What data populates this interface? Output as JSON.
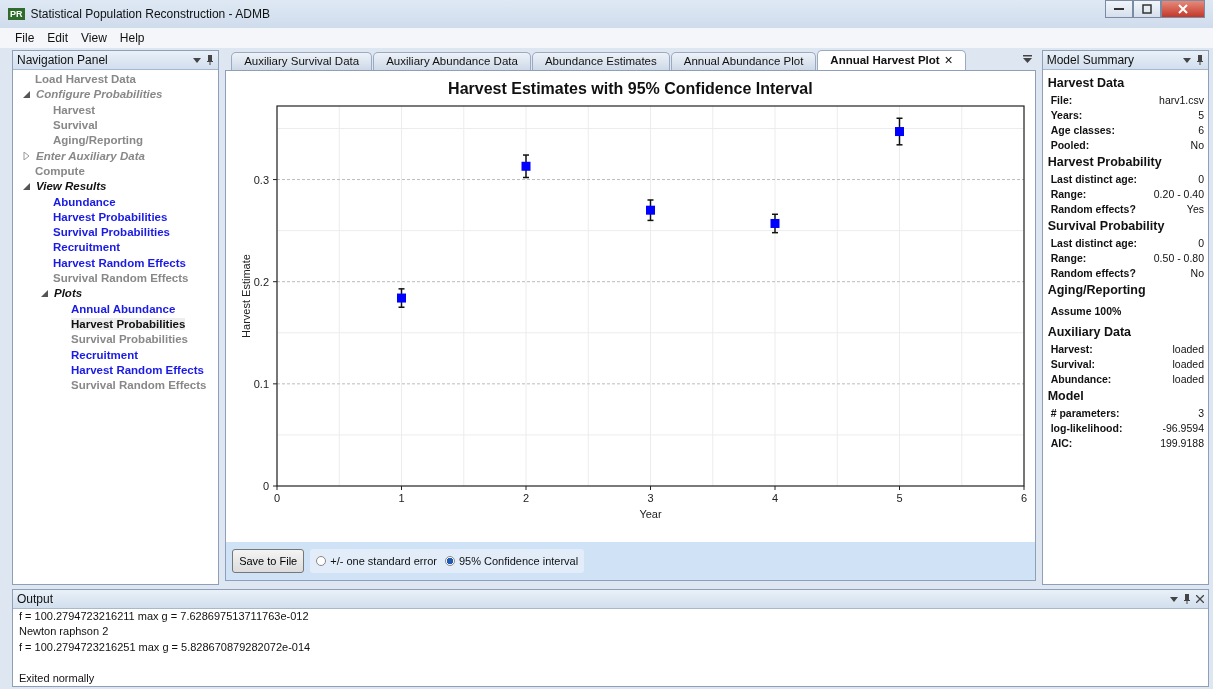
{
  "window": {
    "title": "Statistical Population Reconstruction - ADMB",
    "app_icon_text": "PR"
  },
  "menu": [
    "File",
    "Edit",
    "View",
    "Help"
  ],
  "navigation": {
    "title": "Navigation Panel",
    "items": [
      {
        "label": "Load Harvest Data",
        "kind": "item",
        "disabled": true,
        "selected": false
      },
      {
        "label": "Configure Probabilities",
        "kind": "group",
        "disabled": true,
        "expanded": true,
        "children": [
          {
            "label": "Harvest",
            "kind": "item",
            "disabled": true,
            "selected": false
          },
          {
            "label": "Survival",
            "kind": "item",
            "disabled": true,
            "selected": false
          },
          {
            "label": "Aging/Reporting",
            "kind": "item",
            "disabled": true,
            "selected": false
          }
        ]
      },
      {
        "label": "Enter Auxiliary Data",
        "kind": "group",
        "disabled": true,
        "expanded": false
      },
      {
        "label": "Compute",
        "kind": "item",
        "disabled": true,
        "selected": false
      },
      {
        "label": "View Results",
        "kind": "group",
        "disabled": false,
        "expanded": true,
        "children": [
          {
            "label": "Abundance",
            "kind": "item",
            "disabled": false,
            "selected": false
          },
          {
            "label": "Harvest Probabilities",
            "kind": "item",
            "disabled": false,
            "selected": false
          },
          {
            "label": "Survival Probabilities",
            "kind": "item",
            "disabled": false,
            "selected": false
          },
          {
            "label": "Recruitment",
            "kind": "item",
            "disabled": false,
            "selected": false
          },
          {
            "label": "Harvest Random Effects",
            "kind": "item",
            "disabled": false,
            "selected": false
          },
          {
            "label": "Survival Random Effects",
            "kind": "item",
            "disabled": true,
            "selected": false
          },
          {
            "label": "Plots",
            "kind": "group",
            "disabled": false,
            "expanded": true,
            "children": [
              {
                "label": "Annual Abundance",
                "kind": "item",
                "disabled": false,
                "selected": false
              },
              {
                "label": "Harvest Probabilities",
                "kind": "item",
                "disabled": false,
                "selected": true
              },
              {
                "label": "Survival Probabilities",
                "kind": "item",
                "disabled": true,
                "selected": false
              },
              {
                "label": "Recruitment",
                "kind": "item",
                "disabled": false,
                "selected": false
              },
              {
                "label": "Harvest Random Effects",
                "kind": "item",
                "disabled": false,
                "selected": false
              },
              {
                "label": "Survival Random Effects",
                "kind": "item",
                "disabled": true,
                "selected": false
              }
            ]
          }
        ]
      }
    ]
  },
  "tabs": [
    {
      "label": "Auxiliary Survival Data",
      "selected": false
    },
    {
      "label": "Auxiliary Abundance Data",
      "selected": false
    },
    {
      "label": "Abundance Estimates",
      "selected": false
    },
    {
      "label": "Annual Abundance Plot",
      "selected": false
    },
    {
      "label": "Annual Harvest Plot",
      "selected": true,
      "close": "×"
    }
  ],
  "plot": {
    "chart_data": {
      "type": "scatter",
      "title": "Harvest Estimates with 95% Confidence Interval",
      "xlabel": "Year",
      "ylabel": "Harvest Estimate",
      "x": [
        1,
        2,
        3,
        4,
        5
      ],
      "grid": true,
      "series": [
        {
          "color": "#0000ff",
          "values": [
            0.184,
            0.313,
            0.27,
            0.257,
            0.347
          ],
          "errors": [
            0.009,
            0.011,
            0.01,
            0.009,
            0.013
          ]
        }
      ],
      "xlim": [
        0,
        6
      ],
      "ylim": [
        0,
        0.372
      ],
      "xticks": [
        0,
        1,
        2,
        3,
        4,
        5,
        6
      ],
      "yticks": [
        0,
        0.1,
        0.2,
        0.3
      ]
    },
    "save_button": "Save to File",
    "options": [
      {
        "label": "+/- one standard error",
        "selected": false
      },
      {
        "label": "95% Confidence interval",
        "selected": true
      }
    ]
  },
  "summary": {
    "title": "Model Summary",
    "sections": [
      {
        "heading": "Harvest Data",
        "rows": [
          {
            "label": "File:",
            "value": "harv1.csv"
          },
          {
            "label": "Years:",
            "value": "5"
          },
          {
            "label": "Age classes:",
            "value": "6"
          },
          {
            "label": "Pooled:",
            "value": "No"
          }
        ]
      },
      {
        "heading": "Harvest Probability",
        "rows": [
          {
            "label": "Last distinct age:",
            "value": "0"
          },
          {
            "label": "Range:",
            "value": "0.20 - 0.40"
          },
          {
            "label": "Random effects?",
            "value": "Yes"
          }
        ]
      },
      {
        "heading": "Survival Probability",
        "rows": [
          {
            "label": "Last distinct age:",
            "value": "0"
          },
          {
            "label": "Range:",
            "value": "0.50 - 0.80"
          },
          {
            "label": "Random effects?",
            "value": "No"
          }
        ]
      },
      {
        "heading": "Aging/Reporting",
        "note": "Assume 100%"
      },
      {
        "heading": "Auxiliary Data",
        "rows": [
          {
            "label": "Harvest:",
            "value": "loaded"
          },
          {
            "label": "Survival:",
            "value": "loaded"
          },
          {
            "label": "Abundance:",
            "value": "loaded"
          }
        ]
      },
      {
        "heading": "Model",
        "rows": [
          {
            "label": "# parameters:",
            "value": "3"
          },
          {
            "label": "log-likelihood:",
            "value": "-96.9594"
          },
          {
            "label": "AIC:",
            "value": "199.9188"
          }
        ]
      }
    ]
  },
  "output": {
    "title": "Output",
    "lines": [
      "f = 100.2794723216211 max g = 7.628697513711763e-012",
      "Newton raphson 2",
      " f = 100.2794723216251 max g = 5.828670879282072e-014",
      "Exited normally"
    ]
  }
}
